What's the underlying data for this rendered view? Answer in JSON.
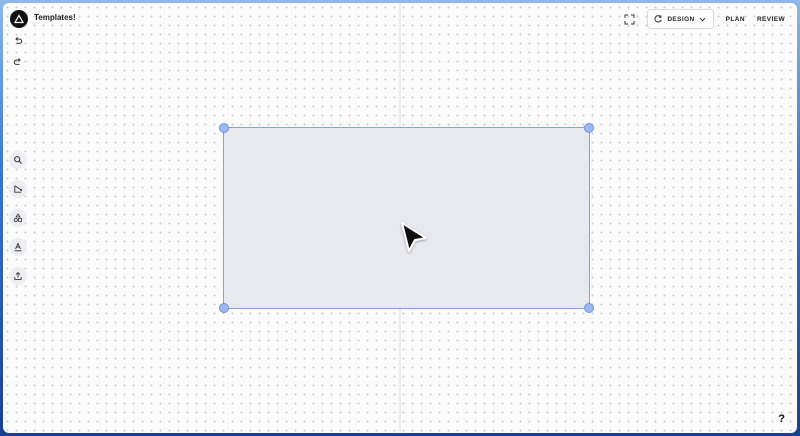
{
  "app": {
    "title": "Templates!"
  },
  "history": {
    "undo_icon": "undo-icon",
    "redo_icon": "redo-icon"
  },
  "toolbar": {
    "items": [
      {
        "name": "search-tool",
        "icon": "search-icon"
      },
      {
        "name": "path-tool",
        "icon": "path-icon"
      },
      {
        "name": "shapes-tool",
        "icon": "shapes-icon"
      },
      {
        "name": "text-tool",
        "icon": "text-style-icon"
      },
      {
        "name": "upload-tool",
        "icon": "upload-icon"
      }
    ]
  },
  "header": {
    "fullscreen_icon": "fullscreen-icon",
    "mode_select": {
      "value": "DESIGN",
      "icon": "refresh-icon"
    },
    "links": [
      "PLAN",
      "REVIEW"
    ]
  },
  "canvas": {
    "selection": {
      "shape": "rectangle",
      "fill": "#e8e9ee",
      "stroke": "#7fa2ea"
    }
  },
  "help": {
    "label": "?"
  }
}
